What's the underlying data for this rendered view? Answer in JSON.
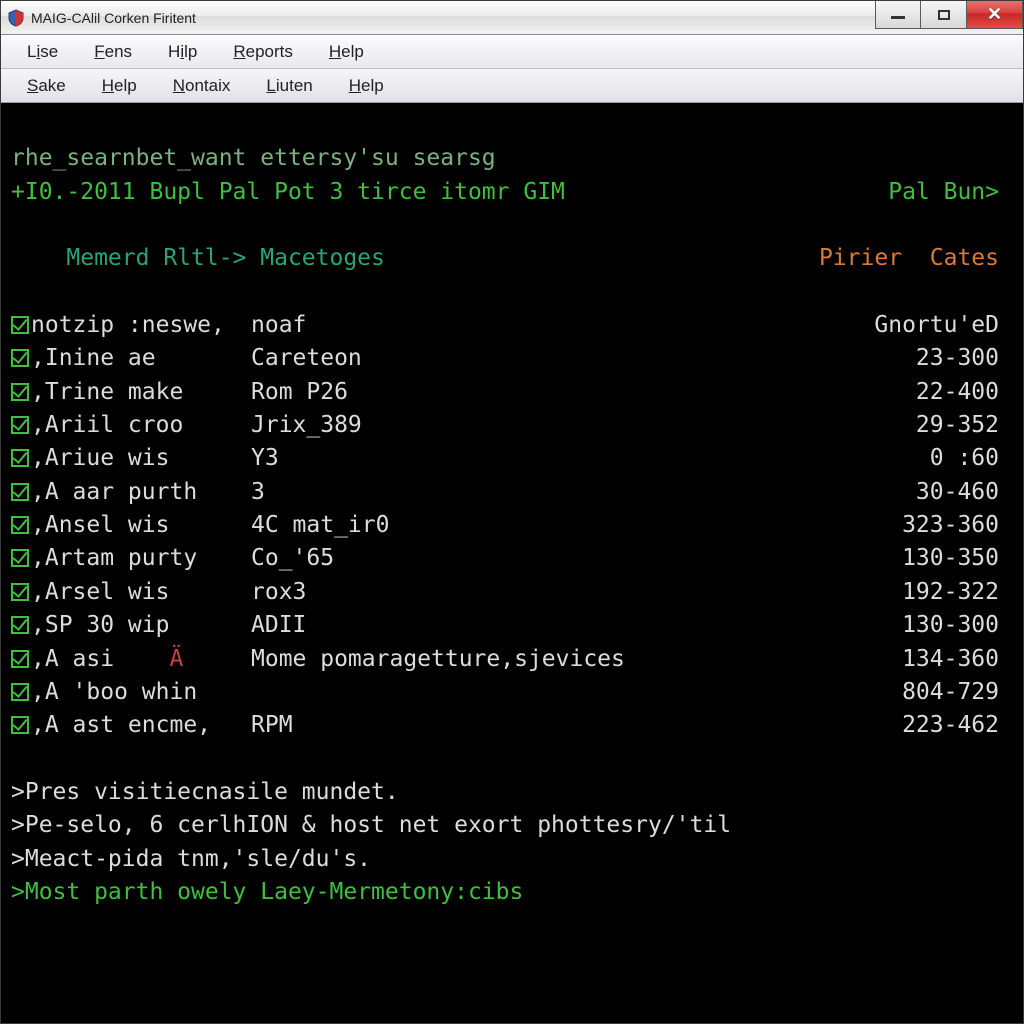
{
  "window": {
    "title": "MAIG-CAlil Corken Firitent"
  },
  "menubar1": {
    "items": [
      {
        "pre": "L",
        "u": "i",
        "post": "se"
      },
      {
        "pre": "",
        "u": "F",
        "post": "ens"
      },
      {
        "pre": "H",
        "u": "i",
        "post": "lp"
      },
      {
        "pre": "",
        "u": "R",
        "post": "eports"
      },
      {
        "pre": "",
        "u": "H",
        "post": "elp"
      }
    ]
  },
  "menubar2": {
    "items": [
      {
        "pre": "",
        "u": "S",
        "post": "ake"
      },
      {
        "pre": "",
        "u": "H",
        "post": "elp"
      },
      {
        "pre": "",
        "u": "N",
        "post": "ontaix"
      },
      {
        "pre": "",
        "u": "L",
        "post": "iuten"
      },
      {
        "pre": "",
        "u": "H",
        "post": "elp"
      }
    ]
  },
  "terminal": {
    "line1": "rhe_searnbet_want ettersy'su searsg",
    "line2_left": "+I0.-2011 Bupl Pal Pot 3 tirce itomr GIM",
    "line2_right": "Pal Bun>",
    "line3_left": "    Memerd Rltl-> Macetoges",
    "line3_r1": "Pirier",
    "line3_r2": "Cates",
    "rows": [
      {
        "c1": "notzip :neswe,",
        "c2": "noaf",
        "val": "Gnortu'eD"
      },
      {
        "c1": ",Inine ae",
        "c2": "Careteon",
        "val": "23-300"
      },
      {
        "c1": ",Trine make",
        "c2": "Rom P26",
        "val": "22-400"
      },
      {
        "c1": ",Ariil croo",
        "c2": "Jrix_389",
        "val": "29-352"
      },
      {
        "c1": ",Ariue wis",
        "c2": "Y3",
        "val": "0 :60"
      },
      {
        "c1": ",A aar purth",
        "c2": "3",
        "val": "30-460"
      },
      {
        "c1": ",Ansel wis",
        "c2": "4C mat_ir0",
        "val": "323-360"
      },
      {
        "c1": ",Artam purty",
        "c2": "Co_'65",
        "val": "130-350"
      },
      {
        "c1": ",Arsel wis",
        "c2": "rox3",
        "val": "192-322"
      },
      {
        "c1": ",SP 30 wip",
        "c2": "ADII",
        "val": "130-300"
      },
      {
        "c1": ",A asi   ",
        "c2": "Mome pomaragetture,sjevices",
        "val": "134-360",
        "glyph": true
      },
      {
        "c1": ",A 'boo whin",
        "c2": "",
        "val": "804-729"
      },
      {
        "c1": ",A ast encme,",
        "c2": "RPM",
        "val": "223-462"
      }
    ],
    "tail": [
      ">Pres visitiecnasile mundet.",
      ">Pe-selo, 6 cerlhION & host net exort phottesry/'til",
      ">Meact-pida tnm,'sle/du's.",
      ">Most parth owely Laey-Mermetony:cibs"
    ]
  }
}
